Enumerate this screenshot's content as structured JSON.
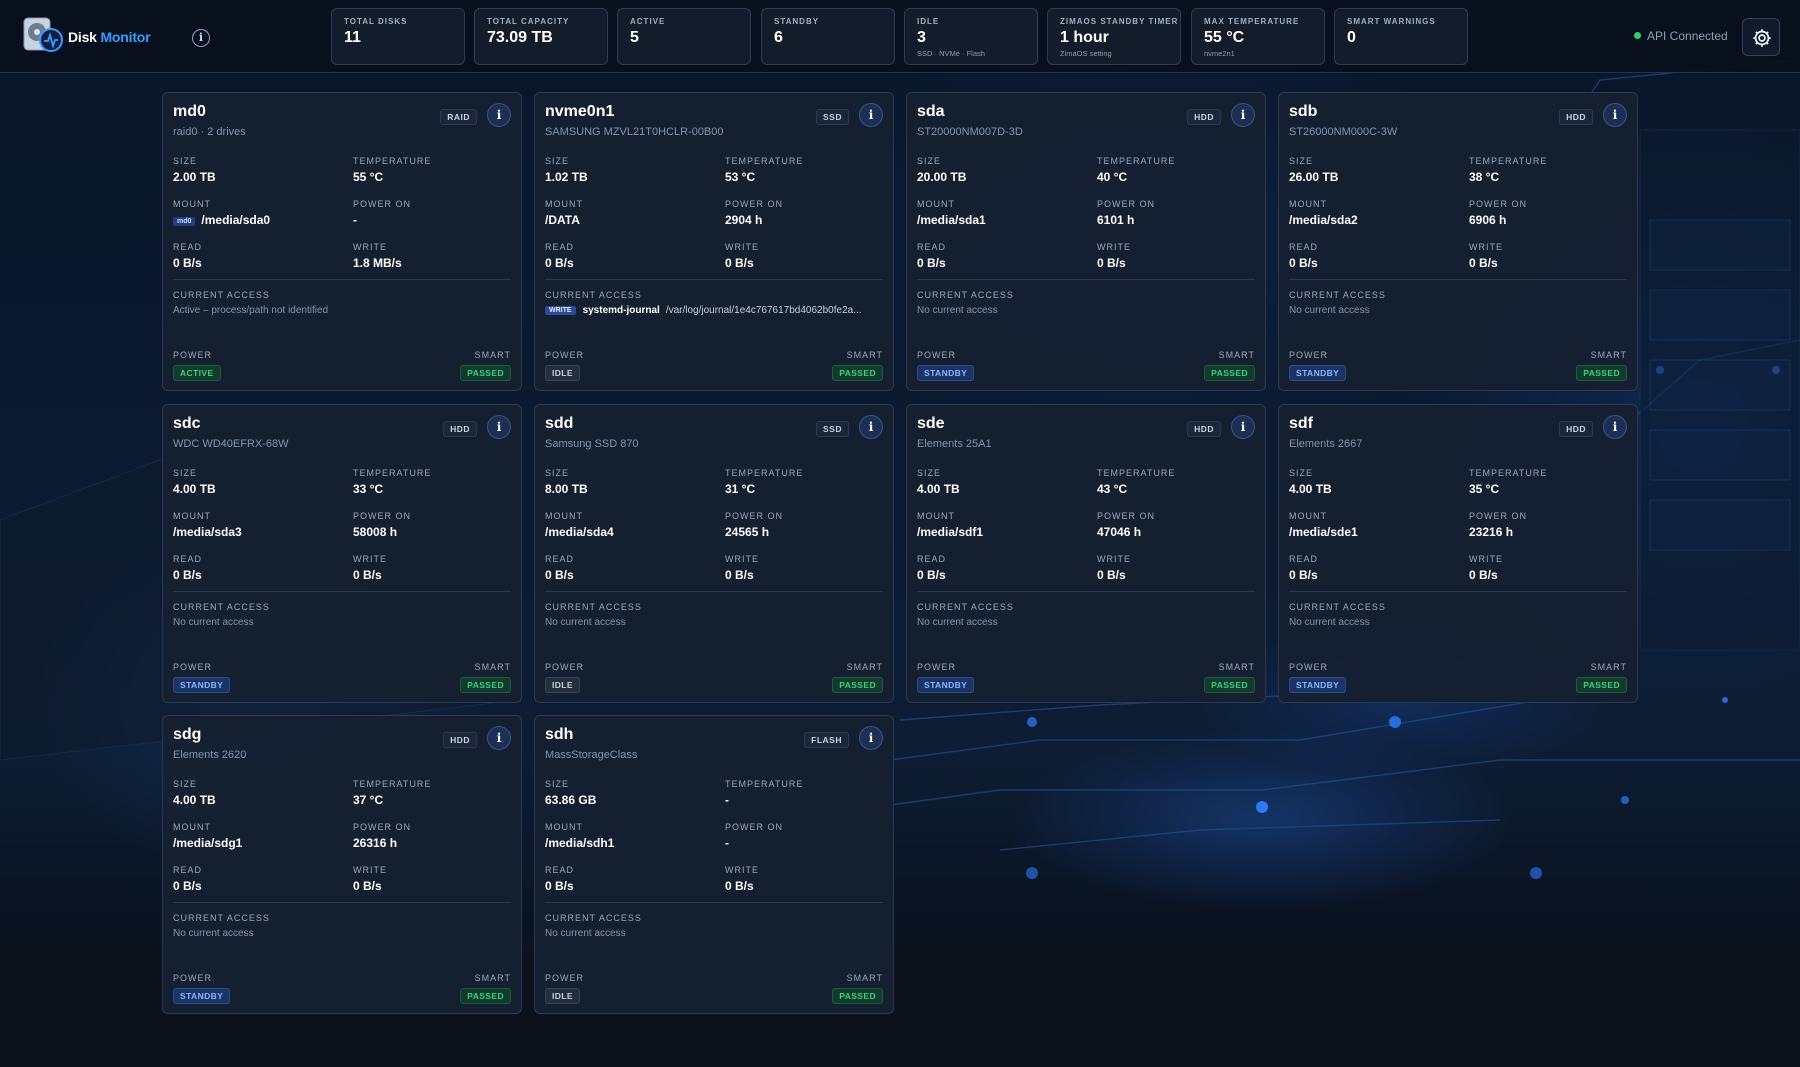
{
  "app": {
    "title_part1": "Disk",
    "title_part2": " Monitor"
  },
  "stats": [
    {
      "label": "TOTAL DISKS",
      "value": "11",
      "sub": ""
    },
    {
      "label": "TOTAL CAPACITY",
      "value": "73.09 TB",
      "sub": ""
    },
    {
      "label": "ACTIVE",
      "value": "5",
      "sub": ""
    },
    {
      "label": "STANDBY",
      "value": "6",
      "sub": ""
    },
    {
      "label": "IDLE",
      "value": "3",
      "sub": "SSD · NVMe · Flash"
    },
    {
      "label": "ZIMAOS STANDBY TIMER",
      "value": "1 hour",
      "sub": "ZimaOS setting"
    },
    {
      "label": "MAX TEMPERATURE",
      "value": "55 °C",
      "sub": "nvme2n1"
    },
    {
      "label": "SMART WARNINGS",
      "value": "0",
      "sub": ""
    }
  ],
  "api_status": "API Connected",
  "labels": {
    "size": "SIZE",
    "temperature": "TEMPERATURE",
    "mount": "MOUNT",
    "power_on": "POWER ON",
    "read": "READ",
    "write": "WRITE",
    "current_access": "CURRENT ACCESS",
    "power": "POWER",
    "smart": "SMART",
    "info": "i",
    "write_badge": "WRITE"
  },
  "colors": {
    "accent": "#3b9cff",
    "active": "#3bd182",
    "standby": "#8bb5ff",
    "idle": "#c6d0dc"
  },
  "disks": [
    {
      "name": "md0",
      "model": "raid0 · 2 drives",
      "type": "RAID",
      "size": "2.00 TB",
      "temperature": "55 °C",
      "mount_badge": "md0",
      "mount": "/media/sda0",
      "power_on": "-",
      "read": "0 B/s",
      "write": "1.8 MB/s",
      "access": "Active – process/path not identified",
      "access_process": "",
      "access_path": "",
      "power": "ACTIVE",
      "smart": "PASSED"
    },
    {
      "name": "nvme0n1",
      "model": "SAMSUNG MZVL21T0HCLR-00B00",
      "type": "SSD",
      "size": "1.02 TB",
      "temperature": "53 °C",
      "mount_badge": "",
      "mount": "/DATA",
      "power_on": "2904 h",
      "read": "0 B/s",
      "write": "0 B/s",
      "access": "",
      "access_process": "systemd-journal",
      "access_path": "/var/log/journal/1e4c767617bd4062b0fe2a...",
      "power": "IDLE",
      "smart": "PASSED"
    },
    {
      "name": "sda",
      "model": "ST20000NM007D-3D",
      "type": "HDD",
      "size": "20.00 TB",
      "temperature": "40 °C",
      "mount_badge": "",
      "mount": "/media/sda1",
      "power_on": "6101 h",
      "read": "0 B/s",
      "write": "0 B/s",
      "access": "No current access",
      "access_process": "",
      "access_path": "",
      "power": "STANDBY",
      "smart": "PASSED"
    },
    {
      "name": "sdb",
      "model": "ST26000NM000C-3W",
      "type": "HDD",
      "size": "26.00 TB",
      "temperature": "38 °C",
      "mount_badge": "",
      "mount": "/media/sda2",
      "power_on": "6906 h",
      "read": "0 B/s",
      "write": "0 B/s",
      "access": "No current access",
      "access_process": "",
      "access_path": "",
      "power": "STANDBY",
      "smart": "PASSED"
    },
    {
      "name": "sdc",
      "model": "WDC WD40EFRX-68W",
      "type": "HDD",
      "size": "4.00 TB",
      "temperature": "33 °C",
      "mount_badge": "",
      "mount": "/media/sda3",
      "power_on": "58008 h",
      "read": "0 B/s",
      "write": "0 B/s",
      "access": "No current access",
      "access_process": "",
      "access_path": "",
      "power": "STANDBY",
      "smart": "PASSED"
    },
    {
      "name": "sdd",
      "model": "Samsung SSD 870",
      "type": "SSD",
      "size": "8.00 TB",
      "temperature": "31 °C",
      "mount_badge": "",
      "mount": "/media/sda4",
      "power_on": "24565 h",
      "read": "0 B/s",
      "write": "0 B/s",
      "access": "No current access",
      "access_process": "",
      "access_path": "",
      "power": "IDLE",
      "smart": "PASSED"
    },
    {
      "name": "sde",
      "model": "Elements 25A1",
      "type": "HDD",
      "size": "4.00 TB",
      "temperature": "43 °C",
      "mount_badge": "",
      "mount": "/media/sdf1",
      "power_on": "47046 h",
      "read": "0 B/s",
      "write": "0 B/s",
      "access": "No current access",
      "access_process": "",
      "access_path": "",
      "power": "STANDBY",
      "smart": "PASSED"
    },
    {
      "name": "sdf",
      "model": "Elements 2667",
      "type": "HDD",
      "size": "4.00 TB",
      "temperature": "35 °C",
      "mount_badge": "",
      "mount": "/media/sde1",
      "power_on": "23216 h",
      "read": "0 B/s",
      "write": "0 B/s",
      "access": "No current access",
      "access_process": "",
      "access_path": "",
      "power": "STANDBY",
      "smart": "PASSED"
    },
    {
      "name": "sdg",
      "model": "Elements 2620",
      "type": "HDD",
      "size": "4.00 TB",
      "temperature": "37 °C",
      "mount_badge": "",
      "mount": "/media/sdg1",
      "power_on": "26316 h",
      "read": "0 B/s",
      "write": "0 B/s",
      "access": "No current access",
      "access_process": "",
      "access_path": "",
      "power": "STANDBY",
      "smart": "PASSED"
    },
    {
      "name": "sdh",
      "model": "MassStorageClass",
      "type": "FLASH",
      "size": "63.86 GB",
      "temperature": "-",
      "mount_badge": "",
      "mount": "/media/sdh1",
      "power_on": "-",
      "read": "0 B/s",
      "write": "0 B/s",
      "access": "No current access",
      "access_process": "",
      "access_path": "",
      "power": "IDLE",
      "smart": "PASSED"
    }
  ]
}
